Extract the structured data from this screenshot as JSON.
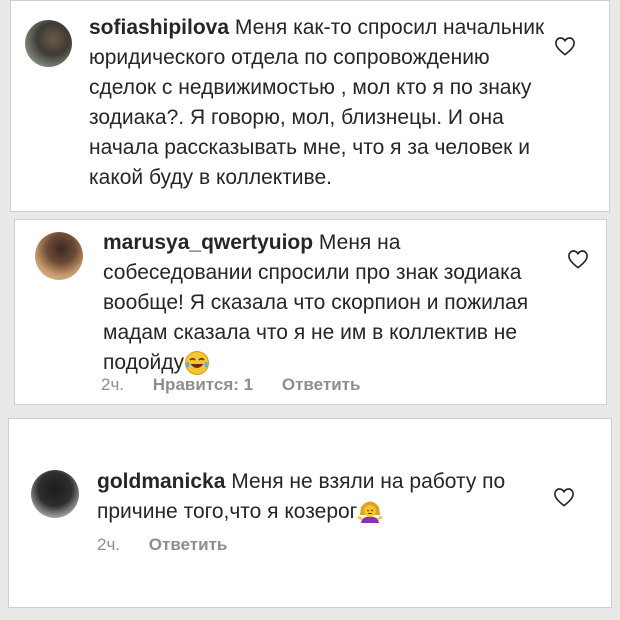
{
  "comments": [
    {
      "username": "sofiashipilova",
      "text": "Меня как-то спросил начальник юридического отдела по сопровождению сделок с недвижимостью , мол кто я по знаку зодиака?. Я говорю, мол, близнецы. И она начала рассказывать мне, что я за человек и какой буду в коллективе.",
      "avatar_icon": "avatar-photo",
      "like_icon": "heart-outline-icon"
    },
    {
      "username": "marusya_qwertyuiop",
      "text": "Меня на собеседовании спросили про знак зодиака вообще! Я сказала что скорпион и пожилая мадам сказала что я не им в коллектив не подойду",
      "emoji": "face-with-tears-of-joy",
      "time": "2ч.",
      "likes": "Нравится: 1",
      "reply": "Ответить",
      "avatar_icon": "avatar-photo",
      "like_icon": "heart-outline-icon"
    },
    {
      "username": "goldmanicka",
      "text": "Меня не взяли на работу по причине того,что я козерог",
      "emoji": "woman-shrugging",
      "time": "2ч.",
      "reply": "Ответить",
      "avatar_icon": "avatar-photo",
      "like_icon": "heart-outline-icon"
    }
  ],
  "colors": {
    "text": "#262626",
    "meta": "#8e8e8e",
    "background": "#e9e9e9",
    "card": "#ffffff"
  }
}
